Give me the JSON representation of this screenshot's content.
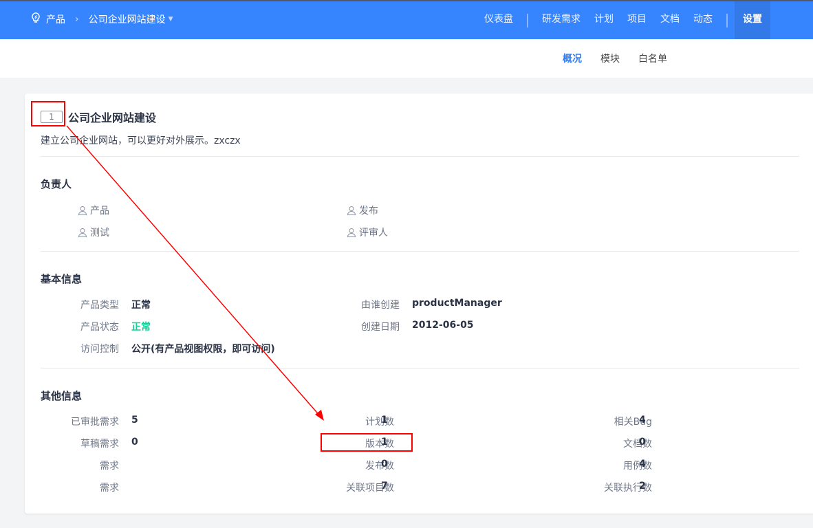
{
  "header": {
    "breadcrumb": [
      "产品",
      "公司企业网站建设"
    ],
    "nav": [
      "仪表盘",
      "研发需求",
      "计划",
      "项目",
      "文档",
      "动态",
      "设置"
    ]
  },
  "subnav": {
    "tabs": [
      "概况",
      "模块",
      "白名单"
    ]
  },
  "product": {
    "id": "1",
    "name": "公司企业网站建设",
    "description": "建立公司企业网站，可以更好对外展示。zxczx"
  },
  "owners": {
    "title": "负责人",
    "items": [
      "产品",
      "发布",
      "测试",
      "评审人"
    ]
  },
  "basic": {
    "title": "基本信息",
    "items": [
      {
        "label": "产品类型",
        "value": "正常"
      },
      {
        "label": "由谁创建",
        "value": "productManager"
      },
      {
        "label": "产品状态",
        "value": "正常"
      },
      {
        "label": "创建日期",
        "value": "2012-06-05"
      },
      {
        "label": "访问控制",
        "value": "公开(有产品视图权限，即可访问)"
      }
    ]
  },
  "other": {
    "title": "其他信息",
    "items": [
      {
        "label": "已审批需求",
        "value": "5"
      },
      {
        "label": "计划数",
        "value": "1"
      },
      {
        "label": "相关Bug",
        "value": "4"
      },
      {
        "label": "草稿需求",
        "value": "0"
      },
      {
        "label": "版本数",
        "value": "1"
      },
      {
        "label": "文档数",
        "value": "0"
      },
      {
        "label": "需求",
        "value": ""
      },
      {
        "label": "发布数",
        "value": "0"
      },
      {
        "label": "用例数",
        "value": "4"
      },
      {
        "label": "需求",
        "value": ""
      },
      {
        "label": "关联项目数",
        "value": "7"
      },
      {
        "label": "关联执行数",
        "value": "2"
      }
    ]
  },
  "colors": {
    "primary": "#3785fe",
    "success": "#17ce97",
    "annotation": "#ff0000"
  }
}
